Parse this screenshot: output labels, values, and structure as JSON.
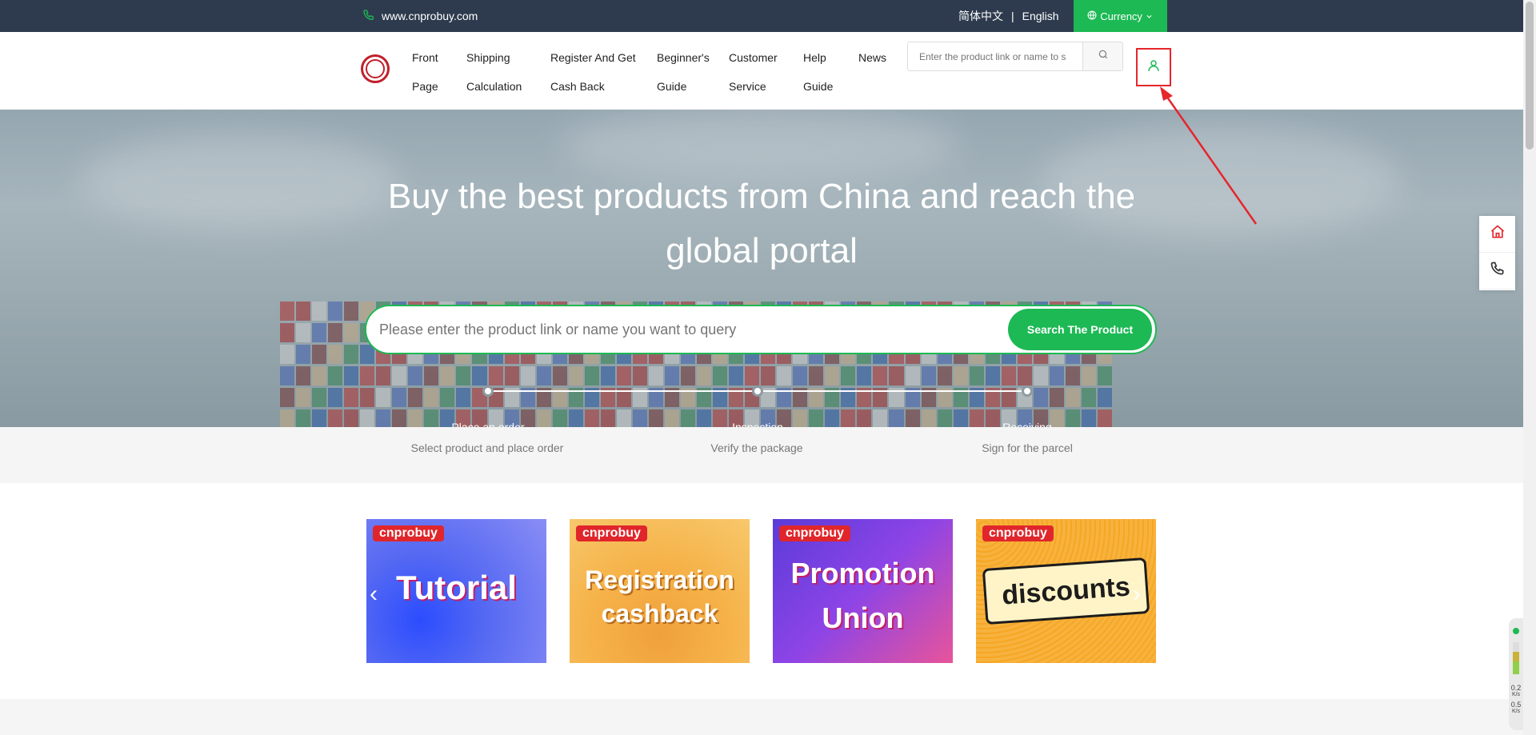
{
  "topbar": {
    "site": "www.cnprobuy.com",
    "lang_cn": "简体中文",
    "sep": "|",
    "lang_en": "English",
    "currency": "Currency"
  },
  "nav": [
    {
      "line1": "Front",
      "line2": "Page"
    },
    {
      "line1": "Shipping",
      "line2": "Calculation"
    },
    {
      "line1": "Register And Get",
      "line2": "Cash Back"
    },
    {
      "line1": "Beginner's",
      "line2": "Guide"
    },
    {
      "line1": "Customer",
      "line2": "Service"
    },
    {
      "line1": "Help",
      "line2": "Guide"
    },
    {
      "line1": "News",
      "line2": ""
    }
  ],
  "header": {
    "search_placeholder": "Enter the product link or name to s"
  },
  "hero": {
    "title_line1": "Buy the best products from China and reach the",
    "title_line2": "global portal",
    "search_placeholder": "Please enter the product link or name you want to query",
    "search_button": "Search The Product",
    "steps": [
      {
        "title": "Place an order",
        "desc": "Select product and place order"
      },
      {
        "title": "Inspection",
        "desc": "Verify the package"
      },
      {
        "title": "Receiving",
        "desc": "Sign for the parcel"
      }
    ]
  },
  "banners": [
    {
      "brand": "cnprobuy",
      "text": "Tutorial"
    },
    {
      "brand": "cnprobuy",
      "text_line1": "Registration",
      "text_line2": "cashback"
    },
    {
      "brand": "cnprobuy",
      "text_line1": "Promotion",
      "text_line2": "Union"
    },
    {
      "brand": "cnprobuy",
      "text": "discounts"
    }
  ],
  "netwidget": {
    "v1": "0.2",
    "u1": "K/s",
    "v2": "0.5",
    "u2": "K/s"
  },
  "colors": {
    "topbar_bg": "#2e3b4e",
    "accent_green": "#1db954",
    "annotation_red": "#e5262b"
  }
}
